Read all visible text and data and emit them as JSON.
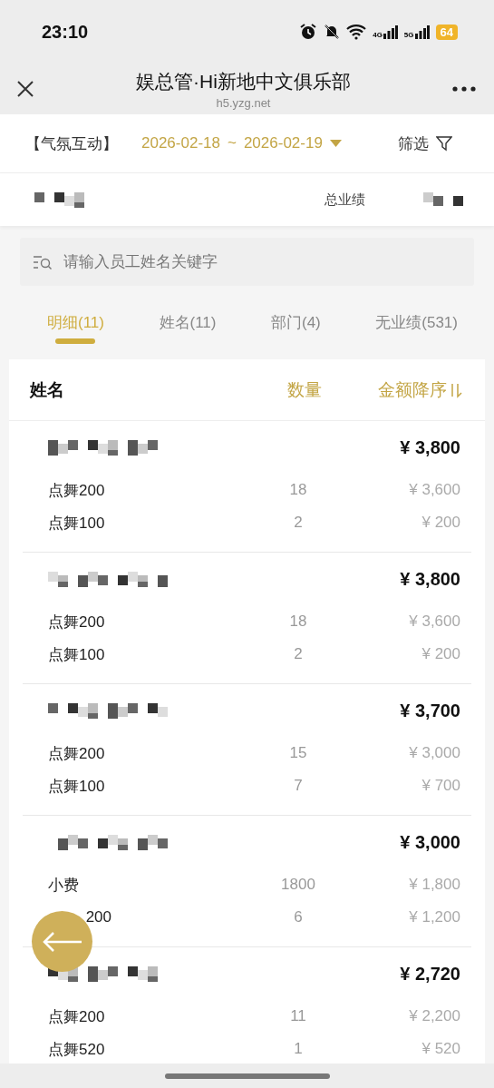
{
  "status_bar": {
    "time": "23:10",
    "network_1": "4G",
    "network_2": "5G",
    "battery": "64"
  },
  "header": {
    "title": "娱总管·Hi新地中文俱乐部",
    "url": "h5.yzg.net"
  },
  "filter_bar": {
    "category": "【气氛互动】",
    "date_from": "2026-02-18",
    "separator": "~",
    "date_to": "2026-02-19",
    "filter_label": "筛选"
  },
  "summary": {
    "name_redacted": true,
    "total_label": "总业绩",
    "total_redacted": true
  },
  "search": {
    "placeholder": "请输入员工姓名关键字"
  },
  "tabs": [
    {
      "label": "明细(11)",
      "selected": true
    },
    {
      "label": "姓名(11)",
      "selected": false
    },
    {
      "label": "部门(4)",
      "selected": false
    },
    {
      "label": "无业绩(531)",
      "selected": false
    }
  ],
  "table": {
    "columns": [
      "姓名",
      "数量",
      "金额降序"
    ],
    "employees": [
      {
        "name_redacted": true,
        "total": "¥ 3,800",
        "items": [
          {
            "label": "点舞200",
            "qty": "18",
            "amount": "¥ 3,600",
            "covered": false
          },
          {
            "label": "点舞100",
            "qty": "2",
            "amount": "¥ 200",
            "covered": false
          }
        ]
      },
      {
        "name_redacted": true,
        "total": "¥ 3,800",
        "items": [
          {
            "label": "点舞200",
            "qty": "18",
            "amount": "¥ 3,600",
            "covered": false
          },
          {
            "label": "点舞100",
            "qty": "2",
            "amount": "¥ 200",
            "covered": false
          }
        ]
      },
      {
        "name_redacted": true,
        "total": "¥ 3,700",
        "items": [
          {
            "label": "点舞200",
            "qty": "15",
            "amount": "¥ 3,000",
            "covered": false
          },
          {
            "label": "点舞100",
            "qty": "7",
            "amount": "¥ 700",
            "covered": false
          }
        ]
      },
      {
        "name_redacted": true,
        "total": "¥ 3,000",
        "items": [
          {
            "label": "小费",
            "qty": "1800",
            "amount": "¥ 1,800",
            "covered": false
          },
          {
            "label": "200",
            "qty": "6",
            "amount": "¥ 1,200",
            "covered": true
          }
        ]
      },
      {
        "name_redacted": true,
        "total": "¥ 2,720",
        "items": [
          {
            "label": "点舞200",
            "qty": "11",
            "amount": "¥ 2,200",
            "covered": false
          },
          {
            "label": "点舞520",
            "qty": "1",
            "amount": "¥ 520",
            "covered": false
          }
        ]
      }
    ]
  }
}
